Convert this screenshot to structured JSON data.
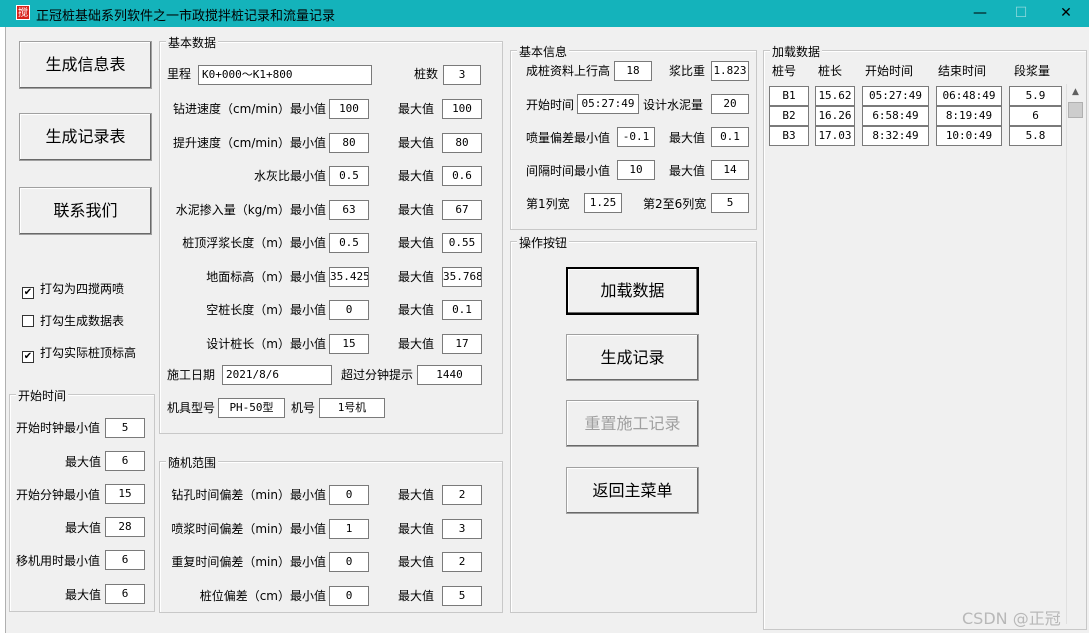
{
  "window": {
    "icon_glyph": "搅",
    "title": "正冠桩基础系列软件之一市政搅拌桩记录和流量记录",
    "minimize": "—",
    "maximize": "☐",
    "close": "✕"
  },
  "left_buttons": {
    "gen_info": "生成信息表",
    "gen_record": "生成记录表",
    "contact": "联系我们"
  },
  "checkboxes": [
    {
      "label": "打勾为四搅两喷",
      "checked": true,
      "mark": "✔"
    },
    {
      "label": "打勾生成数据表",
      "checked": false,
      "mark": ""
    },
    {
      "label": "打勾实际桩顶标高",
      "checked": true,
      "mark": "✔"
    }
  ],
  "start_time": {
    "title": "开始时间",
    "hour_min_label": "开始时钟最小值",
    "hour_min": "5",
    "hour_max_label": "最大值",
    "hour_max": "6",
    "minute_min_label": "开始分钟最小值",
    "minute_min": "15",
    "minute_max_label": "最大值",
    "minute_max": "28",
    "move_min_label": "移机用时最小值",
    "move_min": "6",
    "move_max_label": "最大值",
    "move_max": "6"
  },
  "basic_data": {
    "title": "基本数据",
    "mileage_label": "里程",
    "mileage": "K0+000～K1+800",
    "pile_count_label": "桩数",
    "pile_count": "3",
    "max_label": "最大值",
    "rows": [
      {
        "label": "钻进速度（cm/min）最小值",
        "min": "100",
        "max": "100"
      },
      {
        "label": "提升速度（cm/min）最小值",
        "min": "80",
        "max": "80"
      },
      {
        "label": "水灰比最小值",
        "min": "0.5",
        "max": "0.6"
      },
      {
        "label": "水泥掺入量（kg/m）最小值",
        "min": "63",
        "max": "67"
      },
      {
        "label": "桩顶浮浆长度（m）最小值",
        "min": "0.5",
        "max": "0.55"
      },
      {
        "label": "地面标高（m）最小值",
        "min": "35.425",
        "max": "35.768"
      },
      {
        "label": "空桩长度（m）最小值",
        "min": "0",
        "max": "0.1"
      },
      {
        "label": "设计桩长（m）最小值",
        "min": "15",
        "max": "17"
      }
    ],
    "date_label": "施工日期",
    "date": "2021/8/6",
    "over_minutes_label": "超过分钟提示",
    "over_minutes": "1440",
    "machine_type_label": "机具型号",
    "machine_type": "PH-50型",
    "machine_no_label": "机号",
    "machine_no": "1号机"
  },
  "random_range": {
    "title": "随机范围",
    "max_label": "最大值",
    "rows": [
      {
        "label": "钻孔时间偏差（min）最小值",
        "min": "0",
        "max": "2"
      },
      {
        "label": "喷浆时间偏差（min）最小值",
        "min": "1",
        "max": "3"
      },
      {
        "label": "重复时间偏差（min）最小值",
        "min": "0",
        "max": "2"
      },
      {
        "label": "桩位偏差（cm）最小值",
        "min": "0",
        "max": "5"
      }
    ]
  },
  "basic_info": {
    "title": "基本信息",
    "raise_label": "成桩资料上行高",
    "raise": "18",
    "slurry_ratio_label": "浆比重",
    "slurry_ratio": "1.823",
    "start_time_label": "开始时间",
    "start_time": "05:27:49",
    "design_cement_label": "设计水泥量",
    "design_cement": "20",
    "spray_dev_min_label": "喷量偏差最小值",
    "spray_dev_min": "-0.1",
    "spray_dev_max_label": "最大值",
    "spray_dev_max": "0.1",
    "interval_min_label": "间隔时间最小值",
    "interval_min": "10",
    "interval_max_label": "最大值",
    "interval_max": "14",
    "col1_width_label": "第1列宽",
    "col1_width": "1.25",
    "col2_6_width_label": "第2至6列宽",
    "col2_6_width": "5"
  },
  "operations": {
    "title": "操作按钮",
    "load": "加载数据",
    "generate": "生成记录",
    "reset": "重置施工记录",
    "back": "返回主菜单"
  },
  "loaded_data": {
    "title": "加载数据",
    "headers": [
      "桩号",
      "桩长",
      "开始时间",
      "结束时间",
      "段浆量"
    ],
    "rows": [
      [
        "B1",
        "15.62",
        "05:27:49",
        "06:48:49",
        "5.9"
      ],
      [
        "B2",
        "16.26",
        "6:58:49",
        "8:19:49",
        "6"
      ],
      [
        "B3",
        "17.03",
        "8:32:49",
        "10:0:49",
        "5.8"
      ]
    ]
  },
  "scrollbar": {
    "up": "▲"
  },
  "watermark": "CSDN @正冠"
}
